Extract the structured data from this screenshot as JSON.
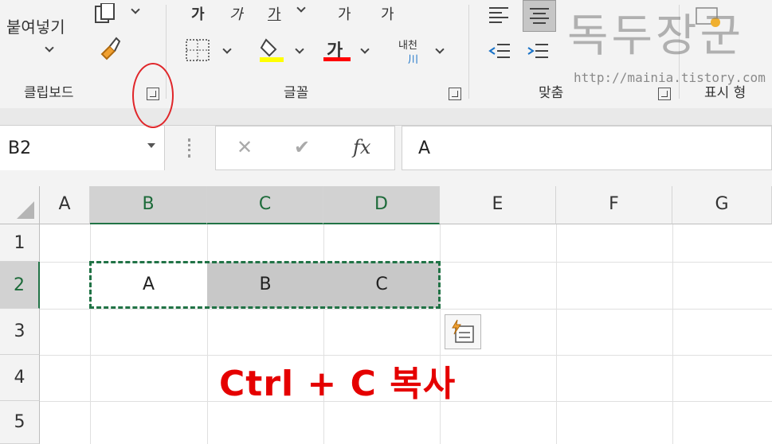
{
  "ribbon": {
    "clipboard": {
      "paste_label": "붙여넣기",
      "group_label": "클립보드"
    },
    "font": {
      "bold_glyph": "가",
      "italic_glyph": "가",
      "underline_glyph": "가",
      "grow_glyph": "가",
      "shrink_glyph": "가",
      "fontcolor_glyph": "가",
      "phonetic_label": "내천",
      "group_label": "글꼴"
    },
    "alignment": {
      "group_label": "맞춤"
    },
    "number": {
      "group_label": "표시 형"
    }
  },
  "formula_bar": {
    "name_box": "B2",
    "cancel_glyph": "✕",
    "enter_glyph": "✔",
    "fx_label": "fx",
    "content": "A"
  },
  "grid": {
    "columns": [
      "A",
      "B",
      "C",
      "D",
      "E",
      "F",
      "G"
    ],
    "rows": [
      "1",
      "2",
      "3",
      "4",
      "5"
    ],
    "cells": {
      "B2": "A",
      "C2": "B",
      "D2": "C"
    }
  },
  "caption": "Ctrl + C 복사",
  "watermark": {
    "title": "독두장군",
    "url": "http://mainia.tistory.com"
  },
  "colors": {
    "accent": "#217346",
    "caption": "#e50000",
    "highlight_yellow": "#ffff00",
    "font_red": "#ff0000"
  }
}
